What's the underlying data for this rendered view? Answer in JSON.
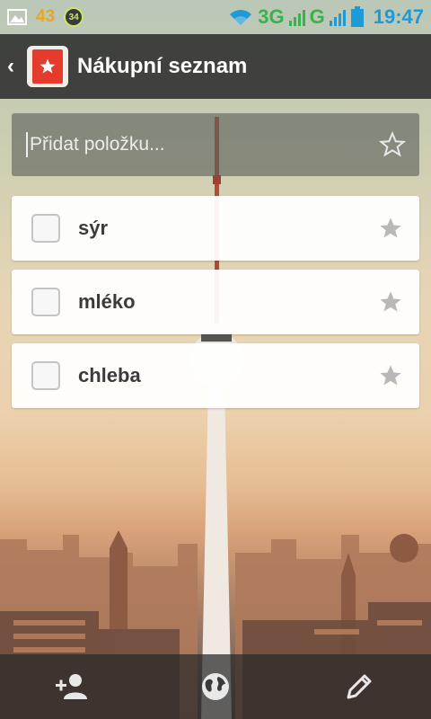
{
  "status_bar": {
    "notification_count": "43",
    "badge_count": "34",
    "network_3g": "3G",
    "network_g": "G",
    "time": "19:47"
  },
  "action_bar": {
    "title": "Nákupní seznam",
    "back_icon": "chevron-left-icon",
    "logo_icon": "wunderlist-star-logo"
  },
  "add_item": {
    "placeholder": "Přidat položku...",
    "value": ""
  },
  "tasks": [
    {
      "label": "sýr",
      "done": false,
      "starred": false
    },
    {
      "label": "mléko",
      "done": false,
      "starred": false
    },
    {
      "label": "chleba",
      "done": false,
      "starred": false
    }
  ],
  "bottom_bar": {
    "icons": [
      "add-person-icon",
      "globe-icon",
      "pencil-icon"
    ]
  },
  "colors": {
    "accent_red": "#e53b2c",
    "action_bar": "#2d2d2d",
    "time_blue": "#1e9ad6",
    "signal_green": "#37b34a",
    "star_grey": "#b8b8b8"
  }
}
